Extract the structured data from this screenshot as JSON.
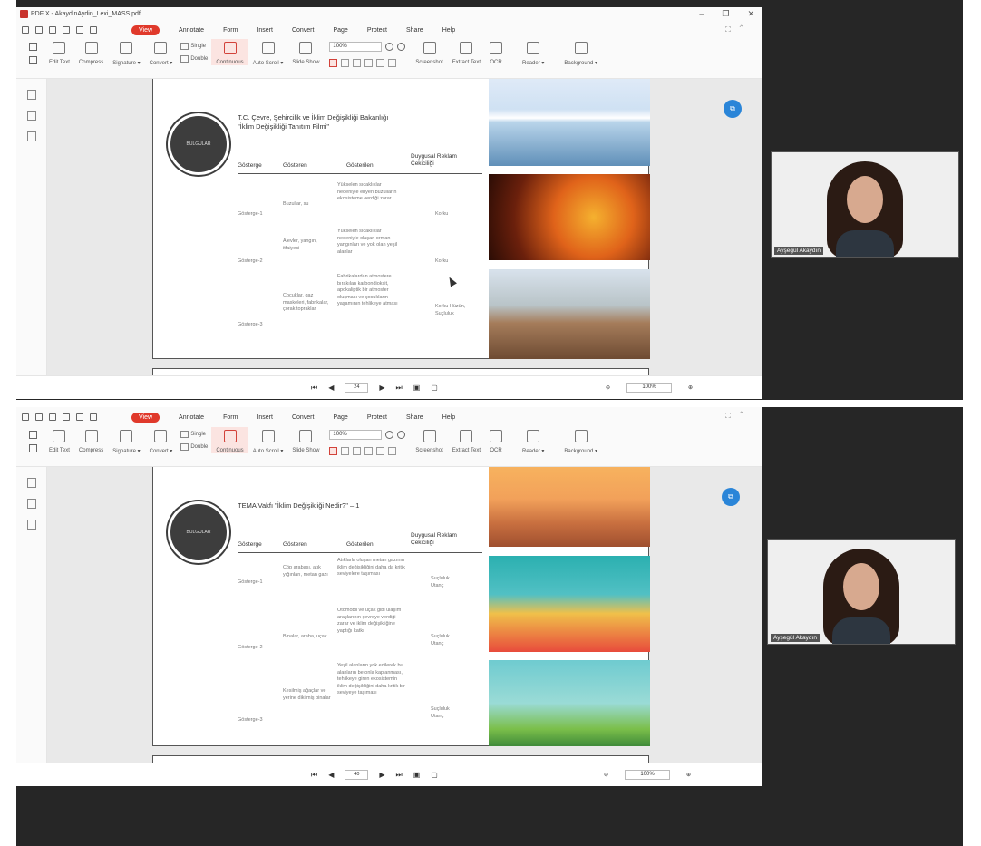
{
  "window": {
    "title": "PDF X - AkaydinAydin_Lexi_MASS.pdf"
  },
  "menu": [
    "View",
    "Annotate",
    "Form",
    "Insert",
    "Convert",
    "Page",
    "Protect",
    "Share",
    "Help"
  ],
  "toolbar": {
    "edit_text": "Edit Text",
    "compress": "Compress",
    "signature": "Signature ▾",
    "convert": "Convert ▾",
    "single": "Single",
    "double": "Double",
    "continuous": "Continuous",
    "auto_scroll": "Auto Scroll ▾",
    "slide_show": "Slide Show",
    "zoom": "100%",
    "screenshot": "Screenshot",
    "extract_text": "Extract Text",
    "ocr": "OCR",
    "reader": "Reader ▾",
    "background": "Background ▾"
  },
  "slide1": {
    "circle": "BULGULAR",
    "title1": "T.C. Çevre, Şehircilik ve İklim Değişikliği Bakanlığı",
    "title2": "\"İklim Değişikliği Tanıtım Filmi\"",
    "headers": [
      "Gösterge",
      "Gösteren",
      "Gösterilen",
      "Duygusal Reklam Çekiciliği"
    ],
    "rows": [
      {
        "g": "Gösterge-1",
        "gs": "Buzullar, su",
        "gl": "Yükselen sıcaklıklar nedeniyle eriyen buzulların ekosisteme verdiği zarar",
        "d": "Korku"
      },
      {
        "g": "Gösterge-2",
        "gs": "Alevler, yangın, itfaiyeci",
        "gl": "Yükselen sıcaklıklar nedeniyle oluşan orman yangınları ve yok olan yeşil alanlar",
        "d": "Korku"
      },
      {
        "g": "Gösterge-3",
        "gs": "Çocuklar, gaz maskeleri, fabrikalar, çorak topraklar",
        "gl": "Fabrikalardan atmosfere bırakılan karbondioksit, apokaliptik bir atmosfer oluşması ve çocukların yaşamının tehlikeye atması",
        "d": "Korku Hüzün, Suçluluk"
      }
    ],
    "page": "24",
    "zoom": "100%"
  },
  "slide2": {
    "circle": "BULGULAR",
    "title1": "TEMA Vakfı \"İklim Değişikliği Nedir?\" – 1",
    "headers": [
      "Gösterge",
      "Gösteren",
      "Gösterilen",
      "Duygusal Reklam Çekiciliği"
    ],
    "rows": [
      {
        "g": "Gösterge-1",
        "gs": "Çöp arabası, atık yığınları, metan gazı",
        "gl": "Atıklarla oluşan metan gazının iklim değişikliğini daha da kritik seviyelere taşıması",
        "d": "Suçluluk Utanç"
      },
      {
        "g": "Gösterge-2",
        "gs": "Binalar, araba, uçak",
        "gl": "Otomobil ve uçak gibi ulaşım araçlarının çevreye verdiği zarar ve iklim değişikliğine yaptığı katkı",
        "d": "Suçluluk Utanç"
      },
      {
        "g": "Gösterge-3",
        "gs": "Kesilmiş ağaçlar ve yerine dikilmiş binalar",
        "gl": "Yeşil alanların yok edilerek bu alanların betonla kaplanması, tehlikeye giren ekosistemin iklim değişikliğini daha kritik bir seviyeye taşıması",
        "d": "Suçluluk Utanç"
      }
    ],
    "page": "40",
    "zoom": "100%"
  },
  "participants": {
    "p1": "Ayşegül Akaydın",
    "p2": "Ayşegül Akaydın"
  },
  "colors": {
    "accent": "#e0392b",
    "fab": "#2a85d8",
    "bg": "#262626"
  }
}
